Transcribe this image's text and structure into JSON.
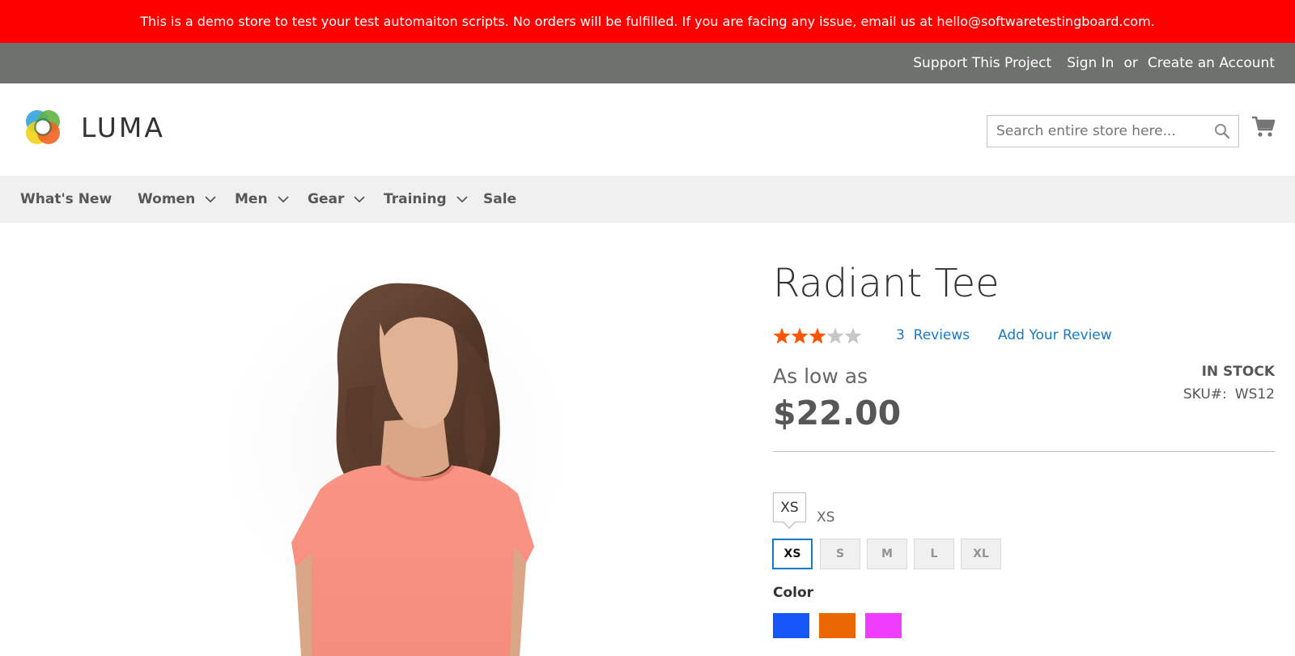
{
  "demo_banner": {
    "text": "This is a demo store to test your test automaiton scripts. No orders will be fulfilled. If you are facing any issue, email us at hello@softwaretestingboard.com."
  },
  "panel_header": {
    "support_label": "Support This Project",
    "sign_in_label": "Sign In",
    "or_label": "or",
    "create_account_label": "Create an Account"
  },
  "header": {
    "logo_text": "LUMA",
    "search_placeholder": "Search entire store here...",
    "search_value": ""
  },
  "nav": {
    "items": [
      {
        "label": "What's New",
        "has_dropdown": false
      },
      {
        "label": "Women",
        "has_dropdown": true
      },
      {
        "label": "Men",
        "has_dropdown": true
      },
      {
        "label": "Gear",
        "has_dropdown": true
      },
      {
        "label": "Training",
        "has_dropdown": true
      },
      {
        "label": "Sale",
        "has_dropdown": false
      }
    ]
  },
  "product": {
    "title": "Radiant Tee",
    "rating_stars": 3,
    "rating_max": 5,
    "reviews_count": "3",
    "reviews_label": "Reviews",
    "add_review_label": "Add Your Review",
    "price_prefix": "As low as",
    "price": "$22.00",
    "stock_status": "IN STOCK",
    "sku_label": "SKU#:",
    "sku_value": "WS12"
  },
  "size": {
    "tooltip": "XS",
    "selected_label": "XS",
    "options": [
      "XS",
      "S",
      "M",
      "L",
      "XL"
    ],
    "selected_index": 0
  },
  "color": {
    "label": "Color",
    "options": [
      {
        "name": "Blue",
        "hex": "#1857f7"
      },
      {
        "name": "Orange",
        "hex": "#eb6703"
      },
      {
        "name": "Purple",
        "hex": "#ef3dff"
      }
    ]
  },
  "colors": {
    "banner_red": "#ff0000",
    "panel_gray": "#6e716e",
    "link_blue": "#1979c3",
    "star_orange": "#ff5501",
    "star_gray": "#c7c7c7",
    "nav_bg": "#f0f0f0"
  }
}
